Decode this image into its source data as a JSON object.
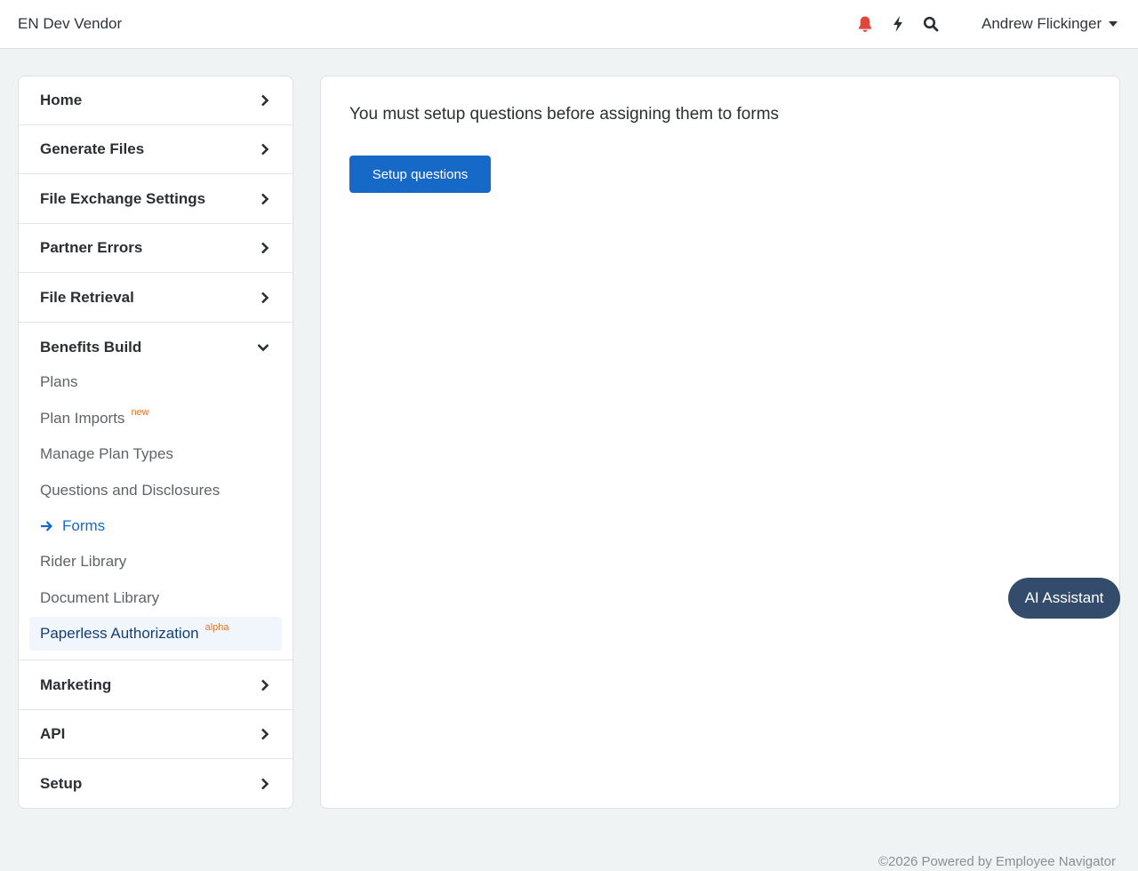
{
  "header": {
    "brand": "EN Dev Vendor",
    "icons": [
      "bell-icon",
      "bolt-icon",
      "search-icon"
    ],
    "user_name": "Andrew Flickinger"
  },
  "sidebar": {
    "sections_top": [
      {
        "label": "Home"
      },
      {
        "label": "Generate Files"
      },
      {
        "label": "File Exchange Settings"
      },
      {
        "label": "Partner Errors"
      },
      {
        "label": "File Retrieval"
      }
    ],
    "benefits": {
      "label": "Benefits Build",
      "items": [
        {
          "label": "Plans"
        },
        {
          "label": "Plan Imports",
          "badge": "new"
        },
        {
          "label": "Manage Plan Types"
        },
        {
          "label": "Questions and Disclosures"
        },
        {
          "label": "Forms",
          "active": true
        },
        {
          "label": "Rider Library"
        },
        {
          "label": "Document Library"
        },
        {
          "label": "Paperless Authorization",
          "badge": "alpha"
        }
      ]
    },
    "sections_bottom": [
      {
        "label": "Marketing"
      },
      {
        "label": "API"
      },
      {
        "label": "Setup"
      }
    ]
  },
  "main": {
    "message": "You must setup questions before assigning them to forms",
    "button_label": "Setup questions"
  },
  "assistant": {
    "label": "AI Assistant"
  },
  "footer": {
    "text": "©2026 Powered by Employee Navigator"
  },
  "colors": {
    "primary": "#1769c7",
    "bell": "#e0463c",
    "badge": "#e8742c",
    "assistant": "#344c6b",
    "background": "#f0f3f4"
  }
}
